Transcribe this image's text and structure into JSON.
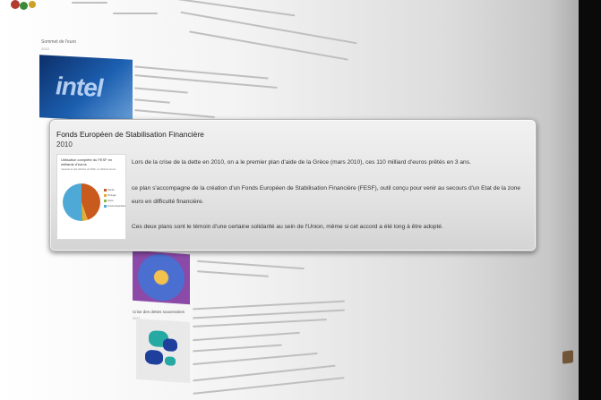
{
  "card": {
    "title": "Fonds Européen de Stabilisation Financière",
    "year": "2010",
    "paragraphs": [
      "Lors de la crise de la dette en 2010, on a le premier plan d'aide de la Grèce (mars 2010), ces 110 milliard d'euros prêtés en 3 ans.",
      "ce plan s'accompagne de la création d'un Fonds Européen de Stabilisation Financière (FESF), outil conçu pour venir au secours d'un Etat de la zone euro en difficulté financière.",
      "Ces deux plans sont le témoin d'une certaine solidarité au sein de l'Union, même si cet accord a été long à être adopté."
    ],
    "thumbnail": {
      "title": "Utilisation complète du FESF en milliards d'euros",
      "subtitle": "Capacité de prêt effective du FESF, en milliards d'euros",
      "legend": [
        "Irlande",
        "Portugal",
        "Grèce",
        "Fonds disponibles"
      ],
      "colors": [
        "#c85a1e",
        "#e9a93c",
        "#8bb44a",
        "#4fa9d6"
      ]
    }
  },
  "background": {
    "section_title": "Sommet de l'euro",
    "section_year": "2010",
    "bottom_title": "Crise des dettes souveraines",
    "bottom_year": "2011"
  },
  "colors": {
    "card_bg": "#e4e4e4",
    "right_bar": "#0a0a0a"
  }
}
